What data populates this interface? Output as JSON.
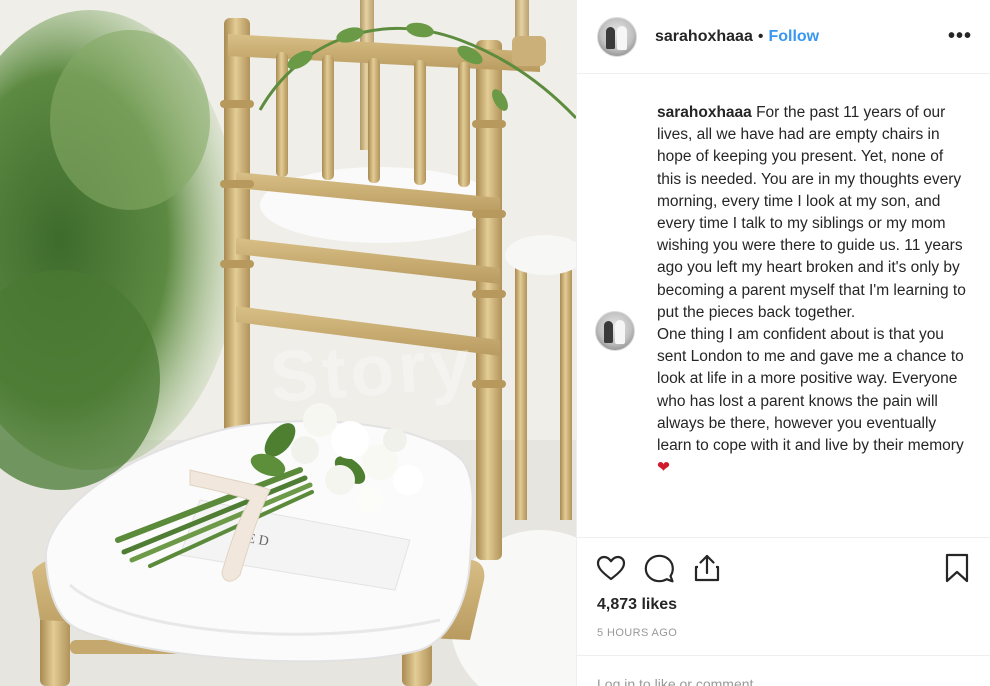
{
  "post": {
    "username": "sarahoxhaaa",
    "separator": "•",
    "follow_label": "Follow",
    "more_label": "•••",
    "caption_user": "sarahoxhaaa",
    "caption_paragraph_1": " For the past 11 years of our lives, all we have had are empty chairs in hope of keeping you present. Yet, none of this is needed. You are in my thoughts every morning, every time I look at my son, and every time I talk to my siblings or my mom wishing you were there to guide us. 11 years ago you left my heart broken and it's only by becoming a parent myself that I'm learning to put the pieces back together.",
    "caption_paragraph_2": "One thing I am confident about is that you sent London to me and gave me a chance to look at life in a more positive way. Everyone who has lost a parent knows the pain will always be there, however you eventually learn to cope with it and live by their memory",
    "caption_emoji": "❤",
    "likes": "4,873 likes",
    "timestamp": "5 HOURS AGO",
    "login_prompt": "Log in to like or comment."
  },
  "photo": {
    "watermark": "Story"
  },
  "icons": {
    "like": "heart-outline-icon",
    "comment": "comment-bubble-icon",
    "share": "share-upload-icon",
    "save": "bookmark-icon"
  },
  "colors": {
    "follow": "#3897f0",
    "text": "#262626",
    "muted": "#999999",
    "heart_emoji": "#d11a2a",
    "chair_gold": "#c9ad74"
  }
}
